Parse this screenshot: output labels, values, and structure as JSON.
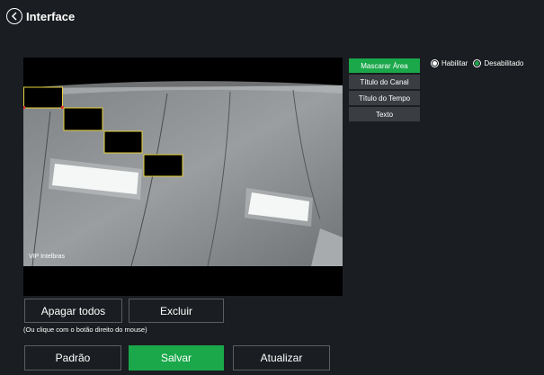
{
  "header": {
    "title": "Interface"
  },
  "video": {
    "overlay_text": "VIP Intelbras"
  },
  "tabs": [
    {
      "label": "Mascarar Área",
      "active": true
    },
    {
      "label": "Título do Canal",
      "active": false
    },
    {
      "label": "Título do Tempo",
      "active": false
    },
    {
      "label": "Texto",
      "active": false
    }
  ],
  "mask_mode": {
    "options": [
      {
        "label": "Habilitar",
        "selected": false
      },
      {
        "label": "Desabilitado",
        "selected": true
      }
    ]
  },
  "actions": {
    "clear_all_label": "Apagar todos",
    "delete_label": "Excluir",
    "hint": "(Ou clique com o botão direito do mouse)"
  },
  "footer": {
    "default_label": "Padrão",
    "save_label": "Salvar",
    "refresh_label": "Atualizar"
  },
  "colors": {
    "accent": "#1aa84a",
    "background": "#1a1d21",
    "tab_inactive": "#3a3d42",
    "mask_border": "#e6d23a"
  }
}
